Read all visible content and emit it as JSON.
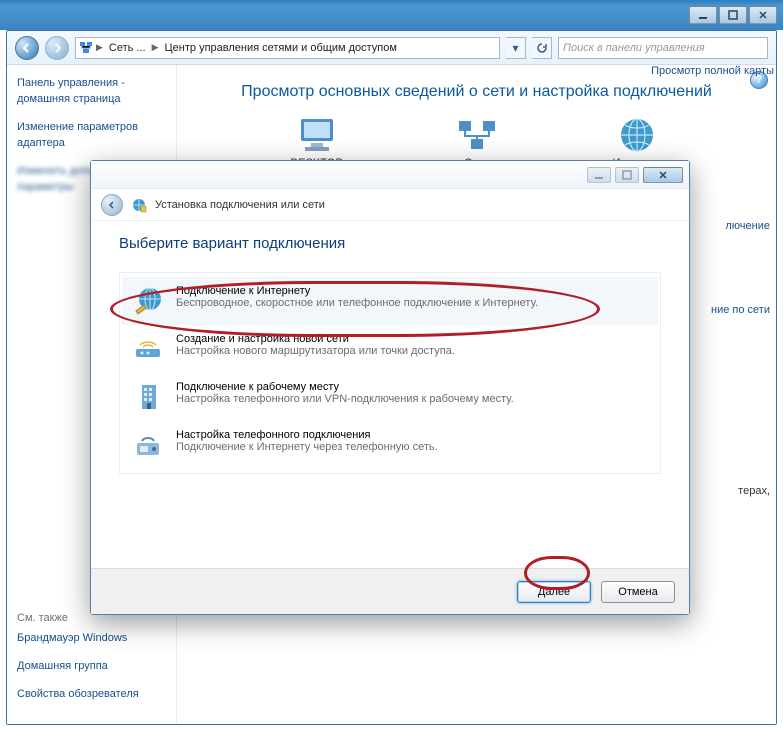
{
  "titlebar": {},
  "addr": {
    "seg1": "Сеть ...",
    "seg2": "Центр управления сетями и общим доступом",
    "search_ph": "Поиск в панели управления"
  },
  "sidebar": {
    "links": [
      "Панель управления - домашняя страница",
      "Изменение параметров адаптера",
      "Изменить дополнительные параметры"
    ],
    "see_title": "См. также",
    "see_links": [
      "Брандмауэр Windows",
      "Домашняя группа",
      "Свойства обозревателя"
    ]
  },
  "main": {
    "title": "Просмотр основных сведений о сети и настройка подключений",
    "map_link": "Просмотр полной карты",
    "net": [
      "DESKTOP",
      "Сеть",
      "Интернет"
    ],
    "blur_hints": [
      "лючение",
      "ние по сети",
      "терах,"
    ]
  },
  "wizard": {
    "crumb": "Установка подключения или сети",
    "heading": "Выберите вариант подключения",
    "options": [
      {
        "title": "Подключение к Интернету",
        "desc": "Беспроводное, скоростное или телефонное подключение к Интернету."
      },
      {
        "title": "Создание и настройка новой сети",
        "desc": "Настройка нового маршрутизатора или точки доступа."
      },
      {
        "title": "Подключение к рабочему месту",
        "desc": "Настройка телефонного или VPN-подключения к рабочему месту."
      },
      {
        "title": "Настройка телефонного подключения",
        "desc": "Подключение к Интернету через телефонную сеть."
      }
    ],
    "next": "Далее",
    "cancel": "Отмена"
  }
}
